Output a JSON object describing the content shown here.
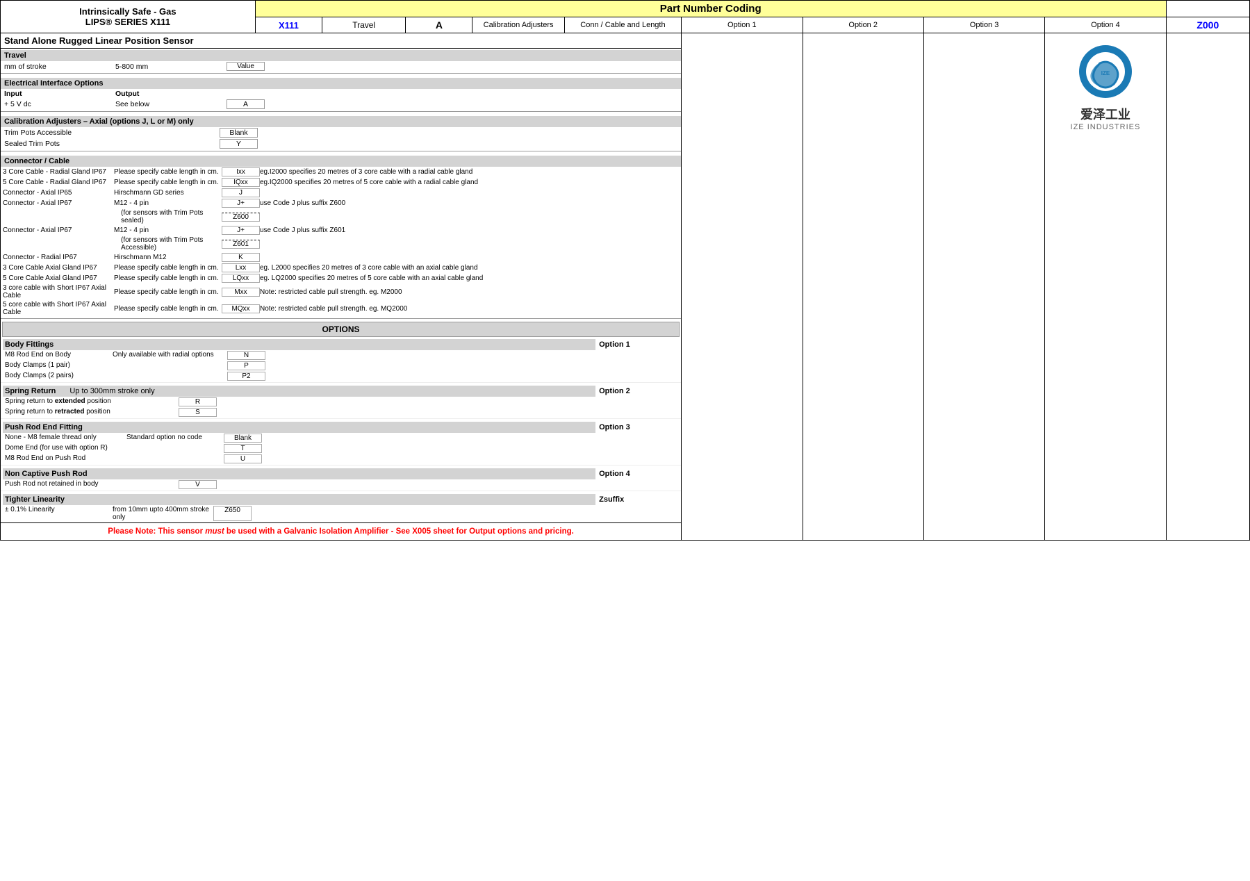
{
  "header": {
    "title_line1": "Intrinsically Safe - Gas",
    "title_line2": "LIPS® SERIES X111",
    "part_number_coding": "Part Number Coding",
    "cols": {
      "x111": "X111",
      "travel": "Travel",
      "a": "A",
      "calib": "Calibration Adjusters",
      "conn": "Conn / Cable and Length",
      "opt1": "Option 1",
      "opt2": "Option 2",
      "opt3": "Option 3",
      "opt4": "Option 4",
      "z000": "Z000"
    }
  },
  "standalone_title": "Stand Alone Rugged Linear Position Sensor",
  "travel_section": {
    "header": "Travel",
    "row1_label": "mm of stroke",
    "row1_value": "5-800 mm",
    "row1_code": "Value"
  },
  "electrical_section": {
    "header": "Electrical Interface Options",
    "sub_input": "Input",
    "sub_output": "Output",
    "row1_label": "+ 5 V  dc",
    "row1_value": "See below",
    "row1_code": "A"
  },
  "calibration_section": {
    "header": "Calibration Adjusters – Axial (options J, L or M) only",
    "row1_label": "Trim Pots Accessible",
    "row1_code": "Blank",
    "row2_label": "Sealed Trim Pots",
    "row2_code": "Y"
  },
  "connector_section": {
    "header": "Connector / Cable",
    "rows": [
      {
        "label": "3 Core Cable - Radial Gland IP67",
        "desc": "Please specify cable length in cm.",
        "code": "Ixx",
        "note": "eg.I2000 specifies 20 metres of 3 core cable with a radial cable gland"
      },
      {
        "label": "5 Core Cable - Radial Gland IP67",
        "desc": "Please specify cable length in cm.",
        "code": "IQxx",
        "note": "eg.IQ2000 specifies 20 metres of 5 core cable with a radial cable gland"
      },
      {
        "label": "Connector - Axial IP65",
        "desc": "Hirschmann GD series",
        "code": "J",
        "note": ""
      },
      {
        "label": "Connector - Axial IP67",
        "desc": "M12 - 4 pin",
        "code": "J+",
        "note": "use Code J plus suffix Z600"
      },
      {
        "label": "",
        "desc": "(for sensors with Trim Pots sealed)",
        "code": "Z600",
        "note": ""
      },
      {
        "label": "Connector - Axial IP67",
        "desc": "M12 - 4 pin",
        "code": "J+",
        "note": "use Code J plus suffix Z601"
      },
      {
        "label": "",
        "desc": "(for sensors with Trim Pots Accessible)",
        "code": "Z601",
        "note": ""
      },
      {
        "label": "Connector - Radial IP67",
        "desc": "Hirschmann M12",
        "code": "K",
        "note": ""
      },
      {
        "label": "3 Core Cable Axial Gland IP67",
        "desc": "Please specify cable length in cm.",
        "code": "Lxx",
        "note": "eg. L2000 specifies 20 metres of 3 core cable with an axial cable gland"
      },
      {
        "label": "5 Core Cable Axial Gland IP67",
        "desc": "Please specify cable length in cm.",
        "code": "LQxx",
        "note": "eg. LQ2000 specifies 20 metres of 5 core cable with an axial cable gland"
      },
      {
        "label": "3 core cable with Short IP67 Axial Cable",
        "desc": "Please specify cable length in cm.",
        "code": "Mxx",
        "note": "Note: restricted cable pull strength. eg. M2000"
      },
      {
        "label": "5 core cable with Short IP67 Axial Cable",
        "desc": "Please specify cable length in cm.",
        "code": "MQxx",
        "note": "Note: restricted cable pull strength. eg. MQ2000"
      }
    ]
  },
  "options_section": {
    "header": "OPTIONS",
    "option1_label": "Option 1",
    "body_fittings": {
      "header": "Body Fittings",
      "rows": [
        {
          "label": "M8 Rod End on Body",
          "desc": "Only available with radial options",
          "code": "N"
        },
        {
          "label": "Body Clamps (1 pair)",
          "desc": "",
          "code": "P"
        },
        {
          "label": "Body Clamps (2 pairs)",
          "desc": "",
          "code": "P2"
        }
      ]
    },
    "option2_label": "Option 2",
    "spring_return": {
      "header": "Spring Return",
      "desc": "Up to 300mm stroke only",
      "rows": [
        {
          "label": "Spring return to extended position",
          "code": "R"
        },
        {
          "label": "Spring return to retracted position",
          "code": "S"
        }
      ]
    },
    "option3_label": "Option 3",
    "push_rod": {
      "header": "Push Rod End Fitting",
      "rows": [
        {
          "label": "None - M8 female thread only",
          "desc": "Standard option no code",
          "code": "Blank"
        },
        {
          "label": "Dome End (for use with option R)",
          "code": "T"
        },
        {
          "label": "M8 Rod End on Push Rod",
          "code": "U"
        }
      ]
    },
    "option4_label": "Option 4",
    "non_captive": {
      "header": "Non Captive Push Rod",
      "rows": [
        {
          "label": "Push Rod not retained in body",
          "code": "V"
        }
      ]
    },
    "zsuffix_label": "Zsuffix",
    "tighter_linearity": {
      "header": "Tighter Linearity",
      "rows": [
        {
          "label": "± 0.1% Linearity",
          "desc": "from 10mm upto 400mm stroke only",
          "code": "Z650"
        }
      ]
    }
  },
  "note": "Please Note: This sensor must be used with a Galvanic Isolation Amplifier - See X005 sheet for Output options and pricing.",
  "ize_logo_text": "爱泽工业",
  "ize_sub_text": "IZE INDUSTRIES"
}
